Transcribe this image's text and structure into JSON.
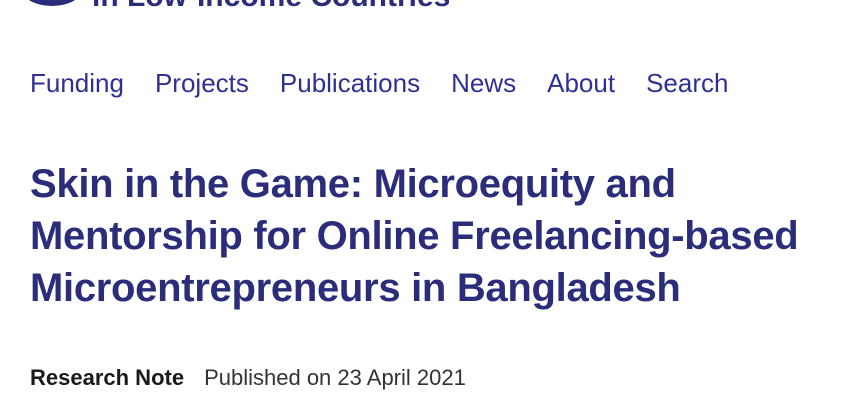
{
  "header": {
    "tagline": "in Low-Income Countries",
    "logo_icon": "circle-logo-icon"
  },
  "nav": {
    "items": [
      {
        "label": "Funding"
      },
      {
        "label": "Projects"
      },
      {
        "label": "Publications"
      },
      {
        "label": "News"
      },
      {
        "label": "About"
      },
      {
        "label": "Search"
      }
    ]
  },
  "article": {
    "title_lines": [
      "Skin in the Game: Microequity and",
      "Mentorship for Online Freelancing-based",
      "Microentrepreneurs in Bangladesh"
    ],
    "type": "Research Note",
    "published": "Published on 23 April 2021"
  },
  "colors": {
    "brand": "#2b2d7a",
    "link": "#2e3192",
    "text": "#1a1a1a"
  }
}
